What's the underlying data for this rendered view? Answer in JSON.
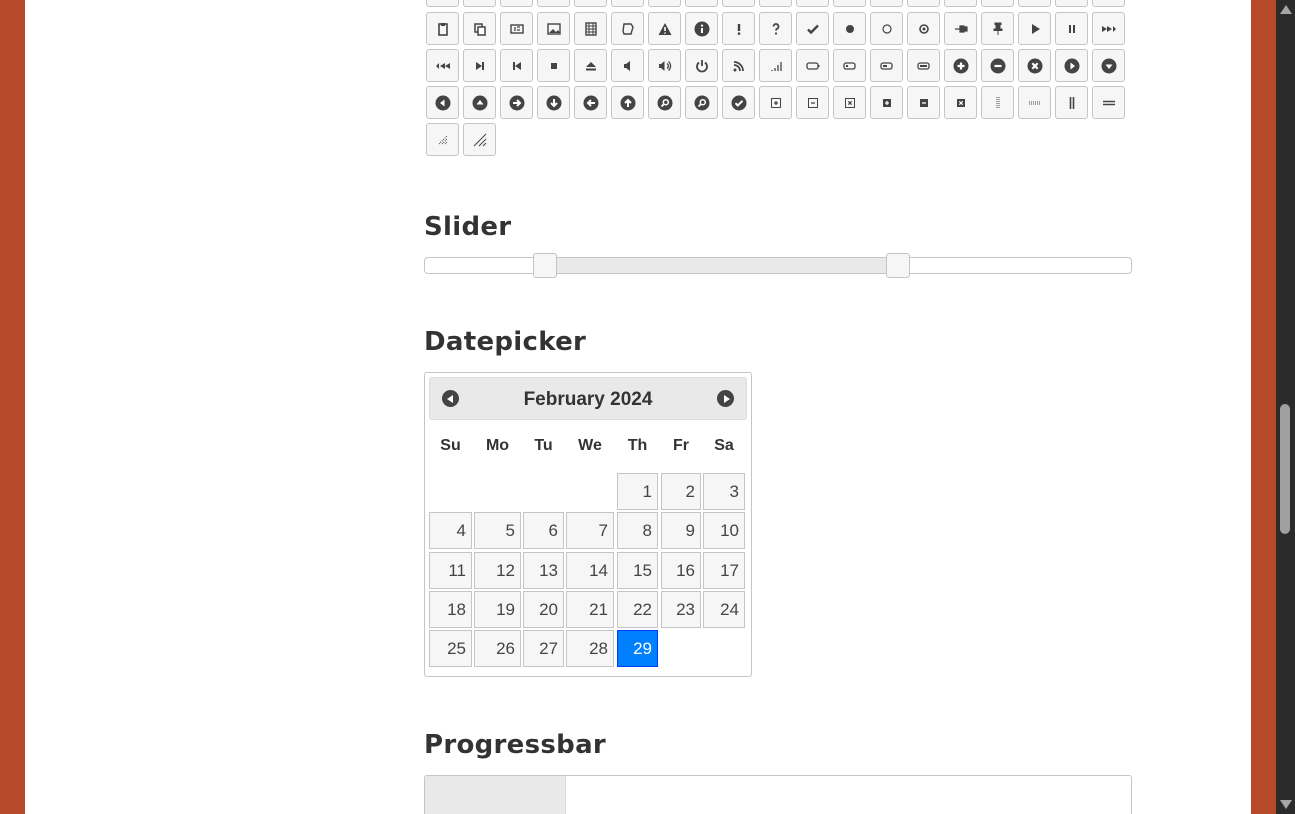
{
  "icon_rows": [
    [
      "clipboard-icon",
      "copy-icon",
      "script-icon",
      "image-icon",
      "video-icon",
      "calculator-icon",
      "alert-icon",
      "info-icon",
      "notice-icon",
      "help-icon",
      "check-icon",
      "bullet-icon",
      "radio-off-icon",
      "radio-on-icon",
      "pin-w-icon",
      "pin-s-icon",
      "play-icon",
      "pause-icon",
      "seek-next-icon"
    ],
    [
      "seek-prev-icon",
      "seek-end-icon",
      "seek-first-icon",
      "stop-icon",
      "eject-icon",
      "volume-off-icon",
      "volume-on-icon",
      "power-icon",
      "signal-diag-icon",
      "signal-icon",
      "battery-0-icon",
      "battery-1-icon",
      "battery-2-icon",
      "battery-3-icon",
      "circle-plus-icon",
      "circle-minus-icon",
      "circle-close-icon",
      "circle-triangle-e-icon",
      "circle-triangle-s-icon"
    ],
    [
      "circle-triangle-w-icon",
      "circle-triangle-n-icon",
      "circle-arrow-e-icon",
      "circle-arrow-s-icon",
      "circle-arrow-w-icon",
      "circle-arrow-n-icon",
      "circle-zoomin-icon",
      "circle-zoomout-icon",
      "circle-check-icon",
      "circlesmall-plus-icon",
      "circlesmall-minus-icon",
      "circlesmall-close-icon",
      "squaresmall-plus-icon",
      "squaresmall-minus-icon",
      "squaresmall-close-icon",
      "grip-dotted-vertical-icon",
      "grip-dotted-horizontal-icon",
      "grip-solid-vertical-icon",
      "grip-solid-horizontal-icon"
    ],
    [
      "gripsmall-diagonal-se-icon",
      "grip-diagonal-se-icon"
    ]
  ],
  "slider": {
    "title": "Slider",
    "range_start": 0.17,
    "range_end": 0.67
  },
  "datepicker": {
    "title": "Datepicker",
    "month_label": "February 2024",
    "prev_label": "Prev",
    "next_label": "Next",
    "weekdays": [
      "Su",
      "Mo",
      "Tu",
      "We",
      "Th",
      "Fr",
      "Sa"
    ],
    "first_weekday_index": 4,
    "days_in_month": 29,
    "selected_day": 29
  },
  "progressbar": {
    "title": "Progressbar",
    "value": 0.2
  },
  "colors": {
    "page_border": "#b5492a",
    "selected_day": "#007fff",
    "scrollbar": "#2b2b2b"
  }
}
